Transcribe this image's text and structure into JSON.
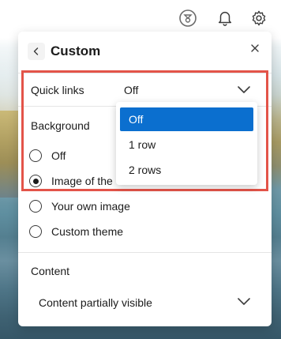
{
  "panel": {
    "title": "Custom"
  },
  "quick_links": {
    "label": "Quick links",
    "value": "Off",
    "options": [
      "Off",
      "1 row",
      "2 rows"
    ],
    "selected_index": 0
  },
  "background": {
    "label": "Background",
    "options": [
      "Off",
      "Image of the day",
      "Your own image",
      "Custom theme"
    ],
    "visible_option_text": {
      "image_of_the_day_partial": "Image of the"
    },
    "selected_index": 1
  },
  "content": {
    "label": "Content",
    "value": "Content partially visible"
  },
  "colors": {
    "highlight_border": "#e35449",
    "selected_option_bg": "#0b6fcf"
  },
  "icons": {
    "top_bar": [
      "rewards-icon",
      "bell-icon",
      "gear-icon"
    ],
    "panel": [
      "back-chevron-icon",
      "close-icon",
      "chevron-down-icon"
    ]
  }
}
